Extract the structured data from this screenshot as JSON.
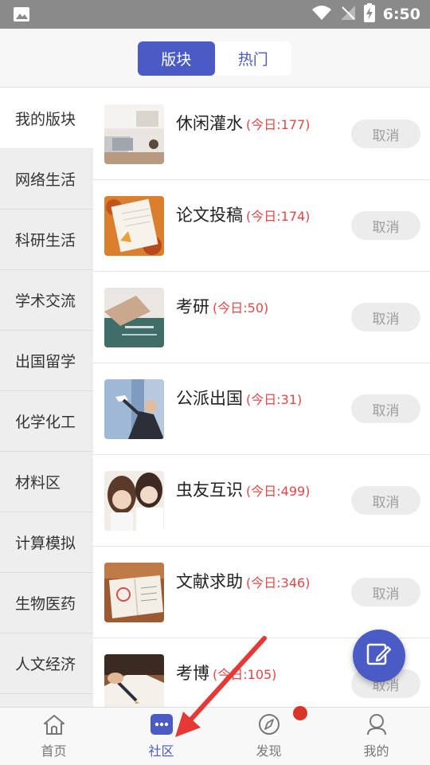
{
  "status_bar": {
    "time": "6:50",
    "icons": [
      "image-icon",
      "wifi-icon",
      "no-signal-icon",
      "battery-charging-icon"
    ]
  },
  "tabs": [
    {
      "label": "版块",
      "active": true
    },
    {
      "label": "热门",
      "active": false
    }
  ],
  "categories": [
    {
      "label": "我的版块",
      "active": true
    },
    {
      "label": "网络生活",
      "active": false
    },
    {
      "label": "科研生活",
      "active": false
    },
    {
      "label": "学术交流",
      "active": false
    },
    {
      "label": "出国留学",
      "active": false
    },
    {
      "label": "化学化工",
      "active": false
    },
    {
      "label": "材料区",
      "active": false
    },
    {
      "label": "计算模拟",
      "active": false
    },
    {
      "label": "生物医药",
      "active": false
    },
    {
      "label": "人文经济",
      "active": false
    }
  ],
  "forums": [
    {
      "name": "休闲灌水",
      "today": "(今日:177)",
      "action": "取消"
    },
    {
      "name": "论文投稿",
      "today": "(今日:174)",
      "action": "取消"
    },
    {
      "name": "考研",
      "today": "(今日:50)",
      "action": "取消"
    },
    {
      "name": "公派出国",
      "today": "(今日:31)",
      "action": "取消"
    },
    {
      "name": "虫友互识",
      "today": "(今日:499)",
      "action": "取消"
    },
    {
      "name": "文献求助",
      "today": "(今日:346)",
      "action": "取消"
    },
    {
      "name": "考博",
      "today": "(今日:105)",
      "action": "取消"
    }
  ],
  "bottom_nav": [
    {
      "label": "首页",
      "icon": "home-icon",
      "active": false
    },
    {
      "label": "社区",
      "icon": "community-icon",
      "active": true
    },
    {
      "label": "发现",
      "icon": "compass-icon",
      "active": false
    },
    {
      "label": "我的",
      "icon": "profile-icon",
      "active": false
    }
  ],
  "colors": {
    "accent": "#4a5bc6",
    "count_red": "#e04848",
    "badge_red": "#d8342a",
    "arrow_red": "#e53935"
  }
}
